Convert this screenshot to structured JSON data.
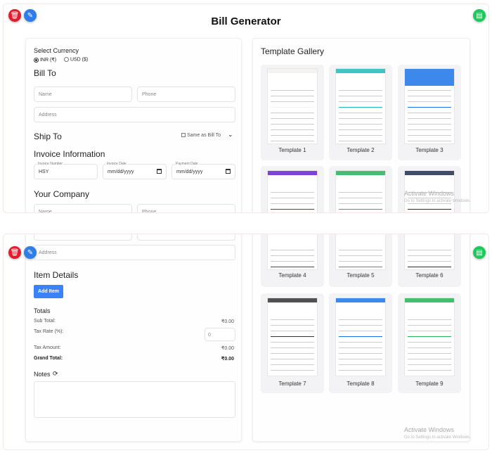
{
  "header": {
    "title": "Bill Generator"
  },
  "icons": {
    "delete": "trash-icon",
    "edit": "edit-icon",
    "generate": "document-icon"
  },
  "currency": {
    "label": "Select Currency",
    "options": [
      "INR (₹)",
      "USD ($)"
    ],
    "selected": "INR (₹)"
  },
  "bill_to": {
    "heading": "Bill To",
    "name_ph": "Name",
    "phone_ph": "Phone",
    "address_ph": "Address"
  },
  "ship_to": {
    "heading": "Ship To",
    "same_label": "Same as Bill To"
  },
  "invoice": {
    "heading": "Invoice Information",
    "number_label": "Invoice Number",
    "number_value": "HSY",
    "date_label": "Invoice Date",
    "date_ph": "mm/dd/yyyy",
    "payment_label": "Payment Date",
    "payment_ph": "mm/dd/yyyy"
  },
  "company": {
    "heading": "Your Company",
    "name_ph": "Name",
    "phone_ph": "Phone",
    "address_ph": "Address"
  },
  "items": {
    "heading": "Item Details",
    "add_label": "Add Item"
  },
  "totals": {
    "heading": "Totals",
    "sub_label": "Sub Total:",
    "sub_value": "₹0.00",
    "tax_rate_label": "Tax Rate (%):",
    "tax_rate_value": "0",
    "tax_amount_label": "Tax Amount:",
    "tax_amount_value": "₹0.00",
    "grand_label": "Grand Total:",
    "grand_value": "₹0.00"
  },
  "notes": {
    "heading": "Notes"
  },
  "gallery": {
    "heading": "Template Gallery",
    "templates": [
      {
        "label": "Template 1",
        "color": "#f4f3ef"
      },
      {
        "label": "Template 2",
        "color": "#1fb8b8"
      },
      {
        "label": "Template 3",
        "color": "#1a73e8"
      },
      {
        "label": "Template 4",
        "color": "#6a1fd6"
      },
      {
        "label": "Template 5",
        "color": "#22b35a"
      },
      {
        "label": "Template 6",
        "color": "#1c2e4a"
      },
      {
        "label": "Template 7",
        "color": "#333333"
      },
      {
        "label": "Template 8",
        "color": "#1a73e8"
      },
      {
        "label": "Template 9",
        "color": "#22b35a"
      }
    ]
  },
  "watermark": {
    "line1": "Activate Windows",
    "line2": "Go to Settings to activate Windows."
  }
}
